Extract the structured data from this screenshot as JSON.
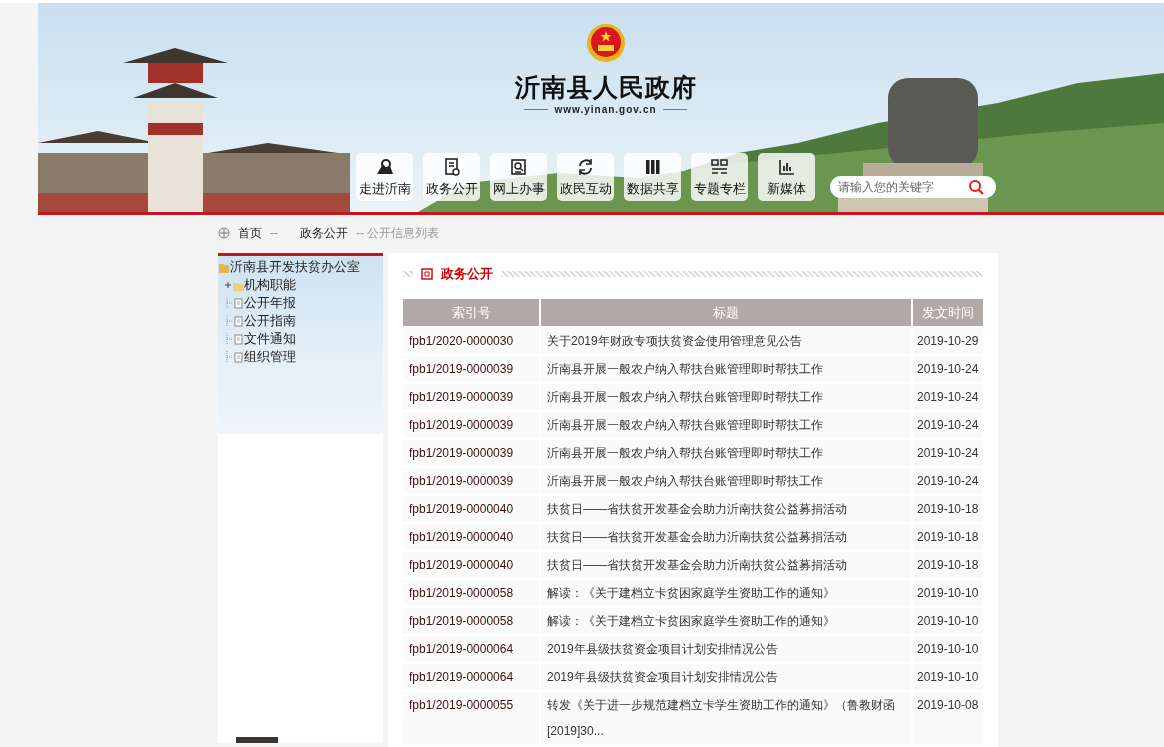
{
  "site": {
    "title": "沂南县人民政府",
    "url": "www.yinan.gov.cn"
  },
  "nav": [
    {
      "label": "走进沂南",
      "kind": "landmark"
    },
    {
      "label": "政务公开",
      "kind": "document"
    },
    {
      "label": "网上办事",
      "kind": "search-doc"
    },
    {
      "label": "政民互动",
      "kind": "exchange"
    },
    {
      "label": "数据共享",
      "kind": "books"
    },
    {
      "label": "专题专栏",
      "kind": "grid"
    },
    {
      "label": "新媒体",
      "kind": "chart"
    }
  ],
  "search": {
    "placeholder": "请输入您的关键字"
  },
  "breadcrumb": [
    {
      "kind": "home",
      "label": "首页"
    },
    {
      "kind": "separator",
      "label": "--"
    },
    {
      "kind": "link",
      "label": "政务公开"
    },
    {
      "kind": "current",
      "label": "-- 公开信息列表"
    }
  ],
  "sidebar": {
    "tree": [
      {
        "label": "沂南县开发扶贫办公室",
        "kind": "root",
        "children": [
          {
            "label": "机构职能",
            "kind": "folder",
            "expanded": false
          },
          {
            "label": "公开年报",
            "kind": "document"
          },
          {
            "label": "公开指南",
            "kind": "document"
          },
          {
            "label": "文件通知",
            "kind": "document"
          },
          {
            "label": "组织管理",
            "kind": "document"
          }
        ]
      }
    ]
  },
  "section": {
    "title": "政务公开"
  },
  "table": {
    "columns": [
      "索引号",
      "标题",
      "发文时间"
    ],
    "rows": [
      {
        "index": "fpb1/2020-0000030",
        "title": "关于2019年财政专项扶贫资金使用管理意见公告",
        "date": "2019-10-29"
      },
      {
        "index": "fpb1/2019-0000039",
        "title": "沂南县开展一般农户纳入帮扶台账管理即时帮扶工作",
        "date": "2019-10-24"
      },
      {
        "index": "fpb1/2019-0000039",
        "title": "沂南县开展一般农户纳入帮扶台账管理即时帮扶工作",
        "date": "2019-10-24"
      },
      {
        "index": "fpb1/2019-0000039",
        "title": "沂南县开展一般农户纳入帮扶台账管理即时帮扶工作",
        "date": "2019-10-24"
      },
      {
        "index": "fpb1/2019-0000039",
        "title": "沂南县开展一般农户纳入帮扶台账管理即时帮扶工作",
        "date": "2019-10-24"
      },
      {
        "index": "fpb1/2019-0000039",
        "title": "沂南县开展一般农户纳入帮扶台账管理即时帮扶工作",
        "date": "2019-10-24"
      },
      {
        "index": "fpb1/2019-0000040",
        "title": "扶贫日——省扶贫开发基金会助力沂南扶贫公益募捐活动",
        "date": "2019-10-18"
      },
      {
        "index": "fpb1/2019-0000040",
        "title": "扶贫日——省扶贫开发基金会助力沂南扶贫公益募捐活动",
        "date": "2019-10-18"
      },
      {
        "index": "fpb1/2019-0000040",
        "title": "扶贫日——省扶贫开发基金会助力沂南扶贫公益募捐活动",
        "date": "2019-10-18"
      },
      {
        "index": "fpb1/2019-0000058",
        "title": "解读：《关于建档立卡贫困家庭学生资助工作的通知》",
        "date": "2019-10-10"
      },
      {
        "index": "fpb1/2019-0000058",
        "title": "解读：《关于建档立卡贫困家庭学生资助工作的通知》",
        "date": "2019-10-10"
      },
      {
        "index": "fpb1/2019-0000064",
        "title": "2019年县级扶贫资金项目计划安排情况公告",
        "date": "2019-10-10"
      },
      {
        "index": "fpb1/2019-0000064",
        "title": "2019年县级扶贫资金项目计划安排情况公告",
        "date": "2019-10-10"
      },
      {
        "index": "fpb1/2019-0000055",
        "title": "转发《关于进一步规范建档立卡学生资助工作的通知》（鲁教财函[2019]30...",
        "date": "2019-10-08"
      }
    ]
  }
}
